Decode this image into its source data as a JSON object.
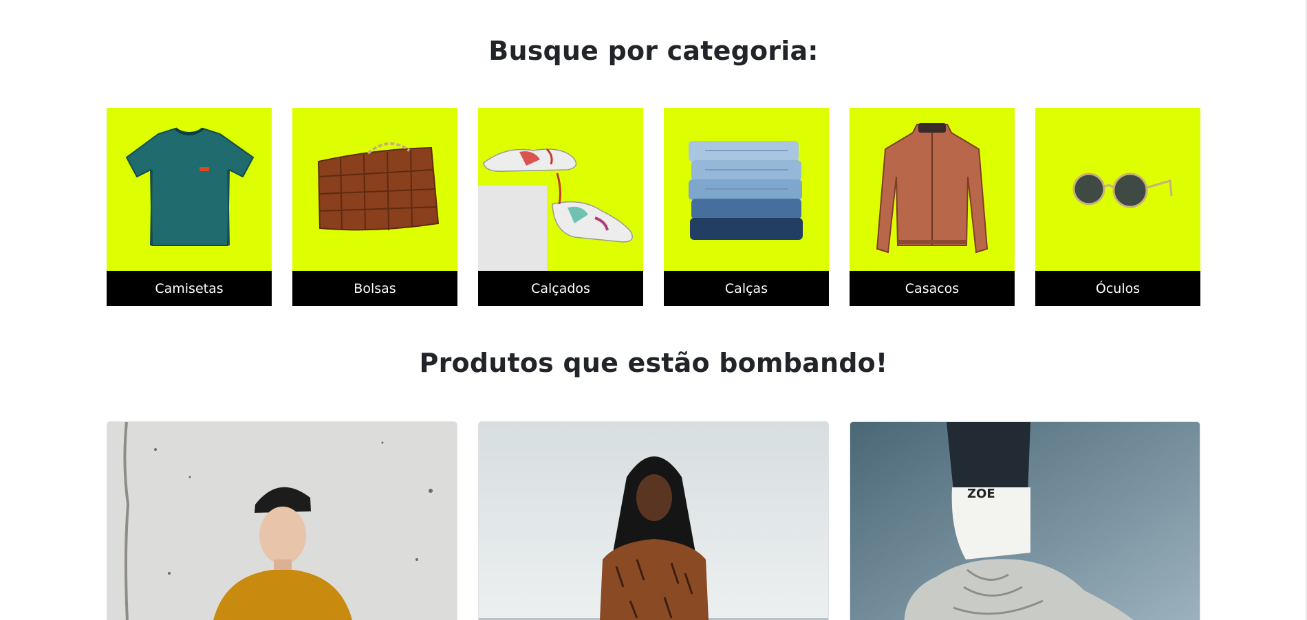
{
  "categories_section": {
    "title": "Busque por categoria:",
    "accent_color": "#ddff00",
    "items": [
      {
        "label": "Camisetas",
        "icon": "tshirt-icon"
      },
      {
        "label": "Bolsas",
        "icon": "handbag-icon"
      },
      {
        "label": "Calçados",
        "icon": "sneakers-icon"
      },
      {
        "label": "Calças",
        "icon": "jeans-icon"
      },
      {
        "label": "Casacos",
        "icon": "jacket-icon"
      },
      {
        "label": "Óculos",
        "icon": "sunglasses-icon"
      }
    ]
  },
  "products_section": {
    "title": "Produtos que estão bombando!",
    "items": [
      {
        "image": "man-beanie-yellow-shirt-photo"
      },
      {
        "image": "woman-braids-leopard-shirt-photo"
      },
      {
        "image": "white-sneakers-socks-photo"
      }
    ]
  }
}
